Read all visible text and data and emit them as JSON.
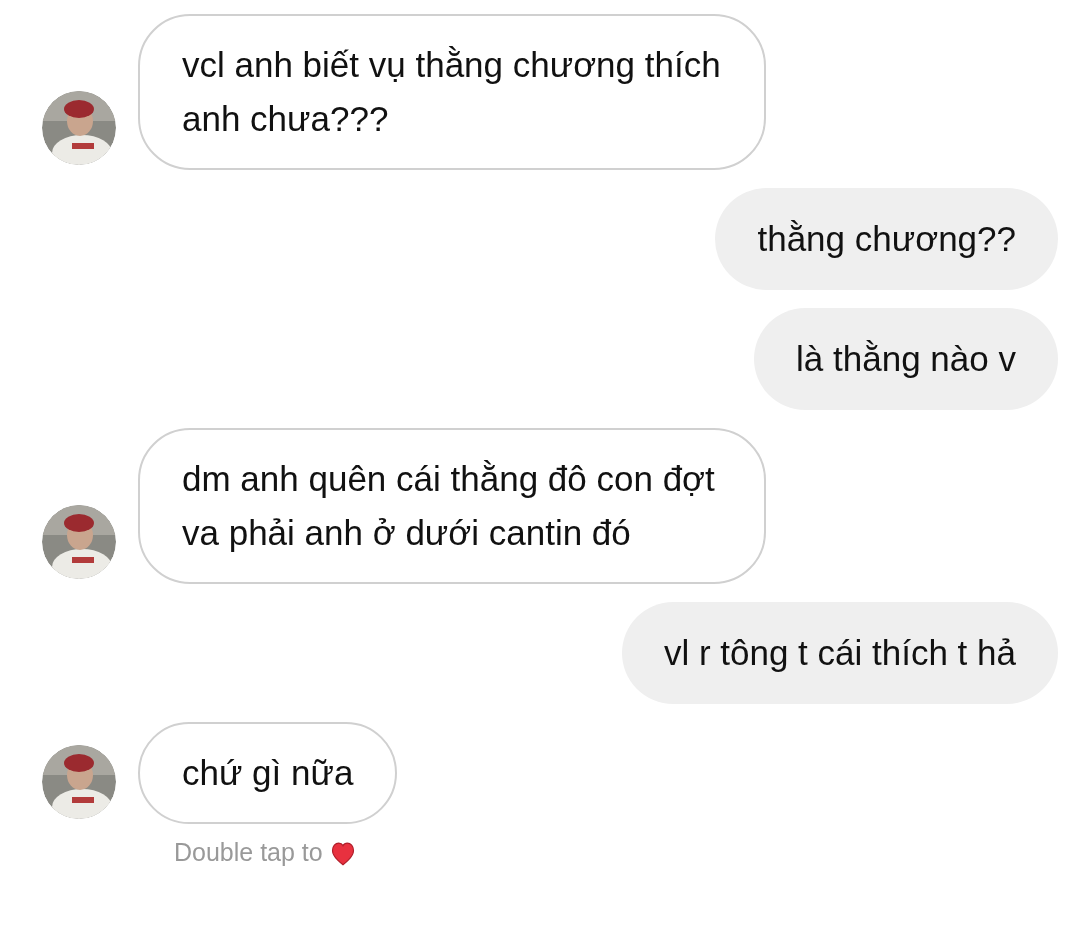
{
  "messages": [
    {
      "kind": "received",
      "text": "vcl anh biết vụ thằng chương thích anh chưa???"
    },
    {
      "kind": "sent",
      "text": "thằng chương??"
    },
    {
      "kind": "sent",
      "text": "là thằng nào v"
    },
    {
      "kind": "received",
      "text": "dm anh quên cái thằng đô con đợt va phải anh ở dưới cantin đó"
    },
    {
      "kind": "sent",
      "text": "vl r tông t cái thích t hả"
    },
    {
      "kind": "received",
      "text": "chứ gì nữa"
    }
  ],
  "hint": "Double tap to"
}
